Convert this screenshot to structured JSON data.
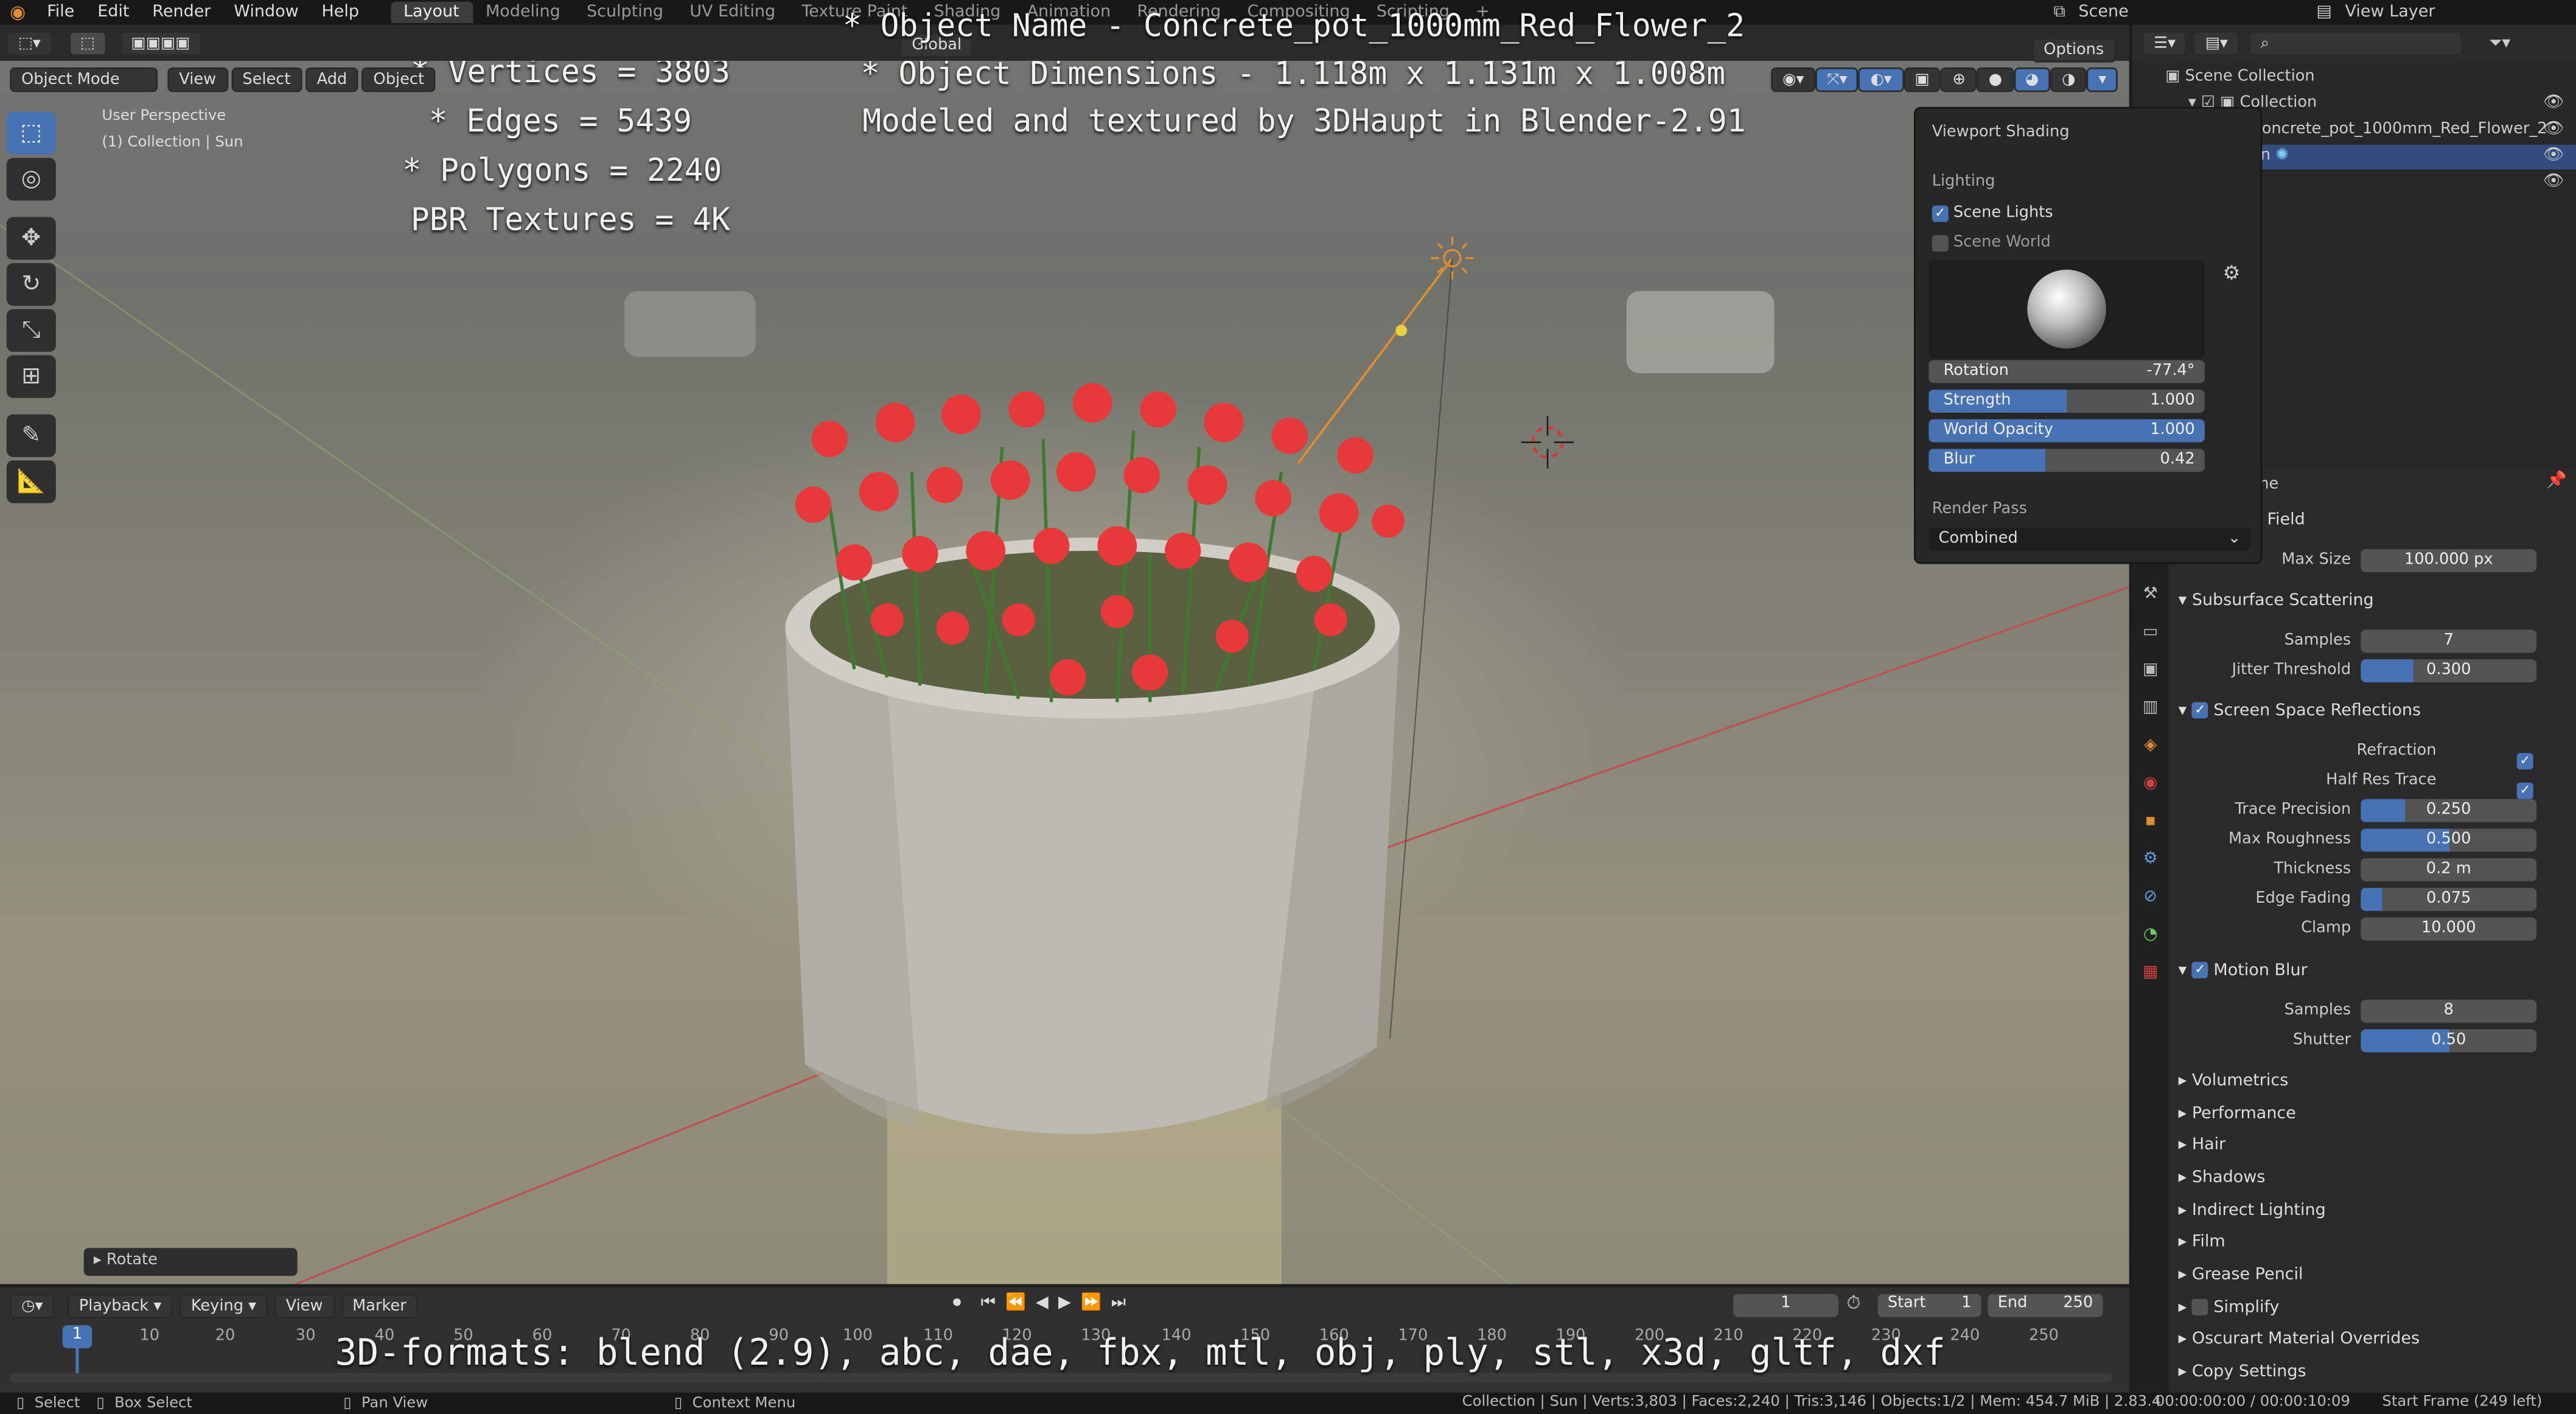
{
  "colors": {
    "accent": "#4772b3",
    "orange": "#e08c30",
    "flower": "#e8393a"
  },
  "topbar": {
    "menus": [
      "File",
      "Edit",
      "Render",
      "Window",
      "Help"
    ],
    "tabs": [
      "Layout",
      "Modeling",
      "Sculpting",
      "UV Editing",
      "Texture Paint",
      "Shading",
      "Animation",
      "Rendering",
      "Compositing",
      "Scripting"
    ],
    "scene": "Scene",
    "view_layer": "View Layer"
  },
  "header": {
    "mode": "Object Mode",
    "menus": [
      "View",
      "Select",
      "Add",
      "Object"
    ],
    "transform": "Global",
    "options": "Options"
  },
  "viewport": {
    "perspective": "User Perspective",
    "collection": "(1) Collection | Sun"
  },
  "overlay": {
    "stats": [
      "* Vertices = 3803",
      "* Edges = 5439",
      "* Polygons = 2240",
      "PBR Textures = 4K"
    ],
    "object_name": "* Object Name - Concrete_pot_1000mm_Red_Flower_2",
    "dimensions": "* Object Dimensions -  1.118m x 1.131m x 1.008m",
    "credit": "Modeled and textured by 3DHaupt in Blender-2.91",
    "formats": "3D-formats: blend (2.9), abc, dae, fbx, mtl, obj, ply, stl, x3d, gltf, dxf"
  },
  "shading": {
    "title": "Viewport Shading",
    "lighting": "Lighting",
    "scene_lights": "Scene Lights",
    "scene_world": "Scene World",
    "sliders": [
      {
        "label": "Rotation",
        "value": "-77.4°",
        "fill": 0
      },
      {
        "label": "Strength",
        "value": "1.000",
        "fill": 0.5
      },
      {
        "label": "World Opacity",
        "value": "1.000",
        "fill": 1.0
      },
      {
        "label": "Blur",
        "value": "0.42",
        "fill": 0.42
      }
    ],
    "render_pass": "Render Pass",
    "render_pass_value": "Combined"
  },
  "outliner": {
    "root": "Scene Collection",
    "collection": "Collection",
    "object": "Concrete_pot_1000mm_Red_Flower_2",
    "sun": "Sun"
  },
  "props": {
    "scene_label": "Scene",
    "field_label": "Field",
    "max_size_label": "Max Size",
    "max_size": "100.000 px",
    "sss": {
      "title": "Subsurface Scattering",
      "samples_label": "Samples",
      "samples": "7",
      "jitter_label": "Jitter Threshold",
      "jitter": "0.300",
      "jitter_fill": 0.3
    },
    "ssr": {
      "title": "Screen Space Reflections",
      "refraction": "Refraction",
      "half_res": "Half Res Trace",
      "fields": [
        {
          "label": "Trace Precision",
          "value": "0.250",
          "fill": 0.25
        },
        {
          "label": "Max Roughness",
          "value": "0.500",
          "fill": 0.5
        },
        {
          "label": "Thickness",
          "value": "0.2 m",
          "fill": 0
        },
        {
          "label": "Edge Fading",
          "value": "0.075",
          "fill": 0.125
        },
        {
          "label": "Clamp",
          "value": "10.000",
          "fill": 0
        }
      ]
    },
    "motion_blur": {
      "title": "Motion Blur",
      "samples_label": "Samples",
      "samples": "8",
      "shutter_label": "Shutter",
      "shutter": "0.50",
      "shutter_fill": 0.5
    },
    "collapsed": [
      "Volumetrics",
      "Performance",
      "Hair",
      "Shadows",
      "Indirect Lighting",
      "Film",
      "Grease Pencil",
      "Simplify",
      "Oscurart Material Overrides",
      "Copy Settings"
    ]
  },
  "timeline": {
    "menus": [
      "Playback",
      "Keying",
      "View",
      "Marker"
    ],
    "current": "1",
    "start_label": "Start",
    "start": "1",
    "end_label": "End",
    "end": "250",
    "ticks": [
      "1",
      "10",
      "20",
      "30",
      "40",
      "50",
      "60",
      "70",
      "80",
      "90",
      "100",
      "110",
      "120",
      "130",
      "140",
      "150",
      "160",
      "170",
      "180",
      "190",
      "200",
      "210",
      "220",
      "230",
      "240",
      "250"
    ]
  },
  "rotate_panel": "Rotate",
  "status": {
    "select": "Select",
    "box_select": "Box Select",
    "pan_view": "Pan View",
    "context_menu": "Context Menu",
    "info": "Collection | Sun | Verts:3,803 | Faces:2,240 | Tris:3,146 | Objects:1/2 | Mem: 454.7 MiB | 2.83.4",
    "time": "00:00:00:00 / 00:00:10:09",
    "start_frame": "Start Frame (249 left)"
  }
}
